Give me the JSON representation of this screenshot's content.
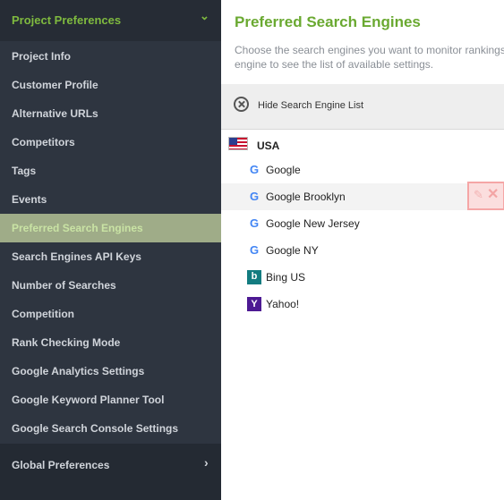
{
  "sidebar": {
    "header": {
      "label": "Project Preferences",
      "chevron": "⌄"
    },
    "items": [
      {
        "label": "Project Info"
      },
      {
        "label": "Customer Profile"
      },
      {
        "label": "Alternative URLs"
      },
      {
        "label": "Competitors"
      },
      {
        "label": "Tags"
      },
      {
        "label": "Events"
      },
      {
        "label": "Preferred Search Engines",
        "active": true
      },
      {
        "label": "Search Engines API Keys"
      },
      {
        "label": "Number of Searches"
      },
      {
        "label": "Competition"
      },
      {
        "label": "Rank Checking Mode"
      },
      {
        "label": "Google Analytics Settings"
      },
      {
        "label": "Google Keyword Planner Tool"
      },
      {
        "label": "Google Search Console Settings"
      }
    ],
    "footer": {
      "label": "Global Preferences",
      "chevron": "›"
    }
  },
  "main": {
    "title": "Preferred Search Engines",
    "description": "Choose the search engines you want to monitor rankings in. Click on an engine to see the list of available settings.",
    "toolbar": {
      "hide_label": "Hide Search Engine List",
      "icon": "close-circle-icon"
    },
    "country": {
      "label": "USA",
      "icon": "us-flag-icon"
    },
    "engines": [
      {
        "label": "Google",
        "icon": "google-icon",
        "glyph": "G"
      },
      {
        "label": "Google Brooklyn",
        "icon": "google-icon",
        "glyph": "G",
        "highlighted": true
      },
      {
        "label": "Google New Jersey",
        "icon": "google-icon",
        "glyph": "G"
      },
      {
        "label": "Google NY",
        "icon": "google-icon",
        "glyph": "G"
      },
      {
        "label": "Bing US",
        "icon": "bing-icon",
        "glyph": "b"
      },
      {
        "label": "Yahoo!",
        "icon": "yahoo-icon",
        "glyph": "Y"
      }
    ],
    "row_actions": {
      "edit_glyph": "✎",
      "delete_glyph": "✕"
    }
  },
  "colors": {
    "sidebar_bg": "#2e3540",
    "accent_green": "#7fba3f",
    "title_green": "#6aa931",
    "active_item_bg": "#9fac88",
    "delete_highlight": "#f5a6a6"
  }
}
